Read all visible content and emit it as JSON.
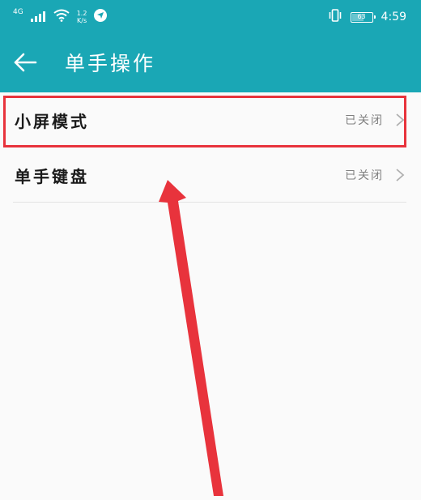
{
  "status_bar": {
    "network_type": "4G",
    "speed_value": "1.2",
    "speed_unit": "K/s",
    "battery_level": "63",
    "time": "4:59"
  },
  "app_bar": {
    "title": "单手操作",
    "back_icon": "arrow-left-icon"
  },
  "settings": [
    {
      "label": "小屏模式",
      "status": "已关闭",
      "highlighted": true
    },
    {
      "label": "单手键盘",
      "status": "已关闭",
      "highlighted": false
    }
  ],
  "annotation": {
    "highlight_color": "#e8333c"
  },
  "colors": {
    "header_bg": "#1aa7b5",
    "page_bg": "#fafafa",
    "status_text": "#808080"
  }
}
